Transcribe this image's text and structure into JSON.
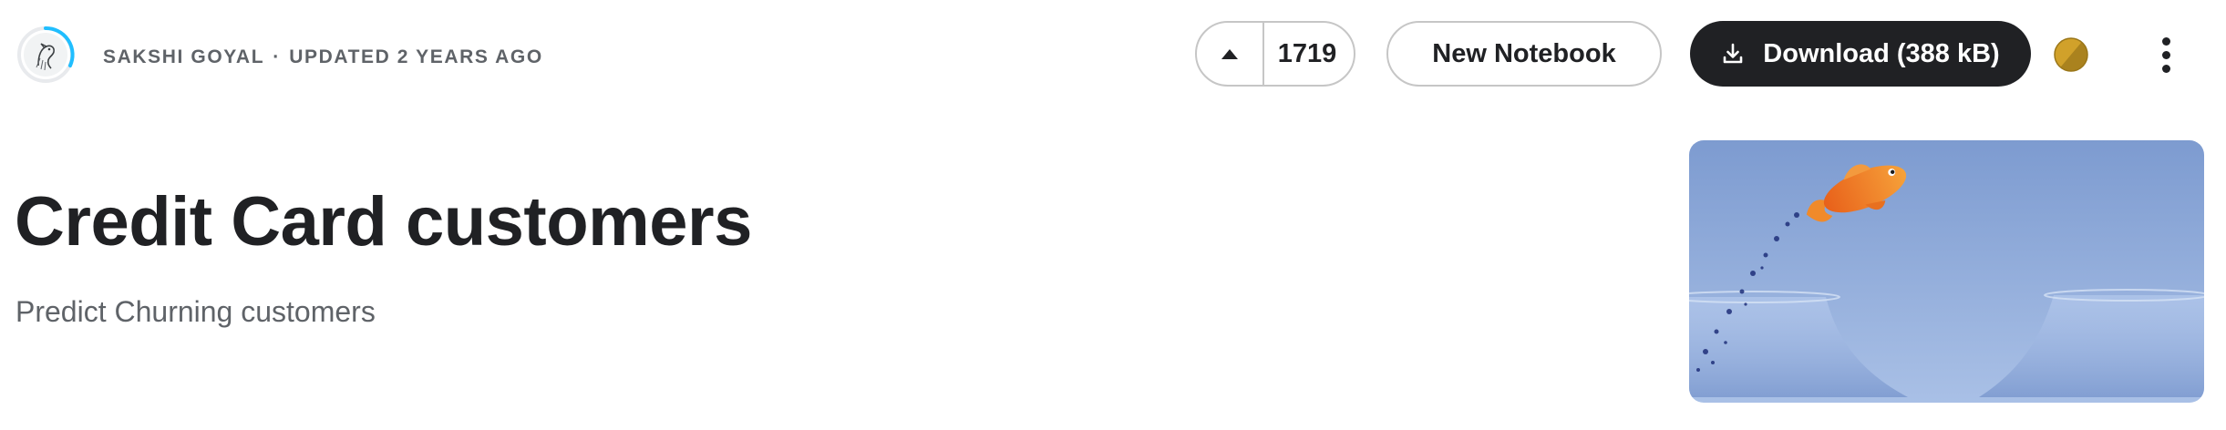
{
  "header": {
    "author": "SAKSHI GOYAL",
    "separator": "·",
    "updated": "UPDATED 2 YEARS AGO",
    "upvote_icon": "caret-up-icon",
    "upvote_count": "1719",
    "new_notebook_label": "New Notebook",
    "download_icon": "download-icon",
    "download_label": "Download (388 kB)",
    "medal_icon": "gold-medal-icon",
    "more_icon": "vertical-dots-icon"
  },
  "dataset": {
    "title": "Credit Card customers",
    "subtitle": "Predict Churning customers"
  },
  "colors": {
    "primary_dark": "#202124",
    "muted_text": "#5f6368",
    "border": "#c6c6c6",
    "progress_ring": "#20beff",
    "medal_gold": "#d1a12a"
  }
}
